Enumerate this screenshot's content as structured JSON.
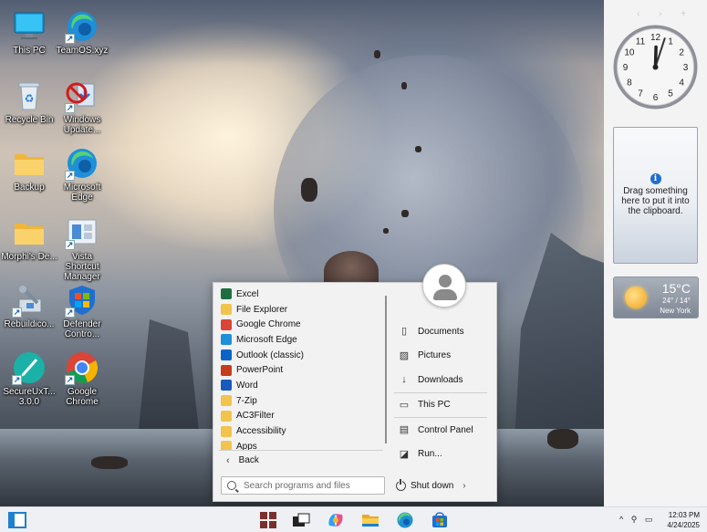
{
  "desktop": {
    "icons": [
      {
        "label": "This PC",
        "icon": "monitor-icon"
      },
      {
        "label": "TeamOS.xyz",
        "icon": "edge-icon"
      },
      {
        "label": "Recycle Bin",
        "icon": "recycle-bin-icon"
      },
      {
        "label": "Windows Update...",
        "icon": "windows-update-icon"
      },
      {
        "label": "Backup",
        "icon": "folder-icon"
      },
      {
        "label": "Microsoft Edge",
        "icon": "edge-icon"
      },
      {
        "label": "Morphi's De...",
        "icon": "folder-icon"
      },
      {
        "label": "Vista Shortcut Manager",
        "icon": "shortcut-manager-icon"
      },
      {
        "label": "Rebuildico...",
        "icon": "rebuild-icon"
      },
      {
        "label": "Defender Contro...",
        "icon": "defender-icon"
      },
      {
        "label": "SecureUxT... 3.0.0",
        "icon": "secureux-icon"
      },
      {
        "label": "Google Chrome",
        "icon": "chrome-icon"
      }
    ]
  },
  "sidebar": {
    "clock": {
      "hour": 12,
      "minute": 3,
      "numbers": [
        "12",
        "1",
        "2",
        "3",
        "4",
        "5",
        "6",
        "7",
        "8",
        "9",
        "10",
        "11"
      ]
    },
    "clipboard_text": "Drag something here to put it into the clipboard.",
    "weather": {
      "temp": "15°C",
      "range": "24° / 14°",
      "city": "New York"
    }
  },
  "start_menu": {
    "programs": [
      {
        "label": "Excel",
        "icon": "excel-icon",
        "color": "#1d6f42"
      },
      {
        "label": "File Explorer",
        "icon": "file-explorer-icon",
        "color": "#f2c44d"
      },
      {
        "label": "Google Chrome",
        "icon": "chrome-icon",
        "color": "#db4437"
      },
      {
        "label": "Microsoft Edge",
        "icon": "edge-icon",
        "color": "#1e8fd8"
      },
      {
        "label": "Outlook (classic)",
        "icon": "outlook-icon",
        "color": "#0a64c8"
      },
      {
        "label": "PowerPoint",
        "icon": "powerpoint-icon",
        "color": "#c43e1c"
      },
      {
        "label": "Word",
        "icon": "word-icon",
        "color": "#185abd"
      },
      {
        "label": "7-Zip",
        "icon": "folder-icon",
        "color": "#f2c44d"
      },
      {
        "label": "AC3Filter",
        "icon": "folder-icon",
        "color": "#f2c44d"
      },
      {
        "label": "Accessibility",
        "icon": "folder-icon",
        "color": "#f2c44d"
      },
      {
        "label": "Apps",
        "icon": "apps-folder-icon",
        "color": "#f2c44d"
      }
    ],
    "back_label": "Back",
    "places": [
      {
        "label": "Documents",
        "icon": "documents-icon",
        "glyph": "▯"
      },
      {
        "label": "Pictures",
        "icon": "pictures-icon",
        "glyph": "▨"
      },
      {
        "label": "Downloads",
        "icon": "downloads-icon",
        "glyph": "↓"
      },
      {
        "label": "This PC",
        "icon": "monitor-icon",
        "glyph": "▭"
      },
      {
        "label": "Control Panel",
        "icon": "control-panel-icon",
        "glyph": "▤"
      },
      {
        "label": "Run...",
        "icon": "run-icon",
        "glyph": "◪"
      }
    ],
    "search_placeholder": "Search programs and files",
    "shutdown_label": "Shut down"
  },
  "taskbar": {
    "time": "12:03 PM",
    "date": "4/24/2025",
    "tray_chevron": "^"
  }
}
